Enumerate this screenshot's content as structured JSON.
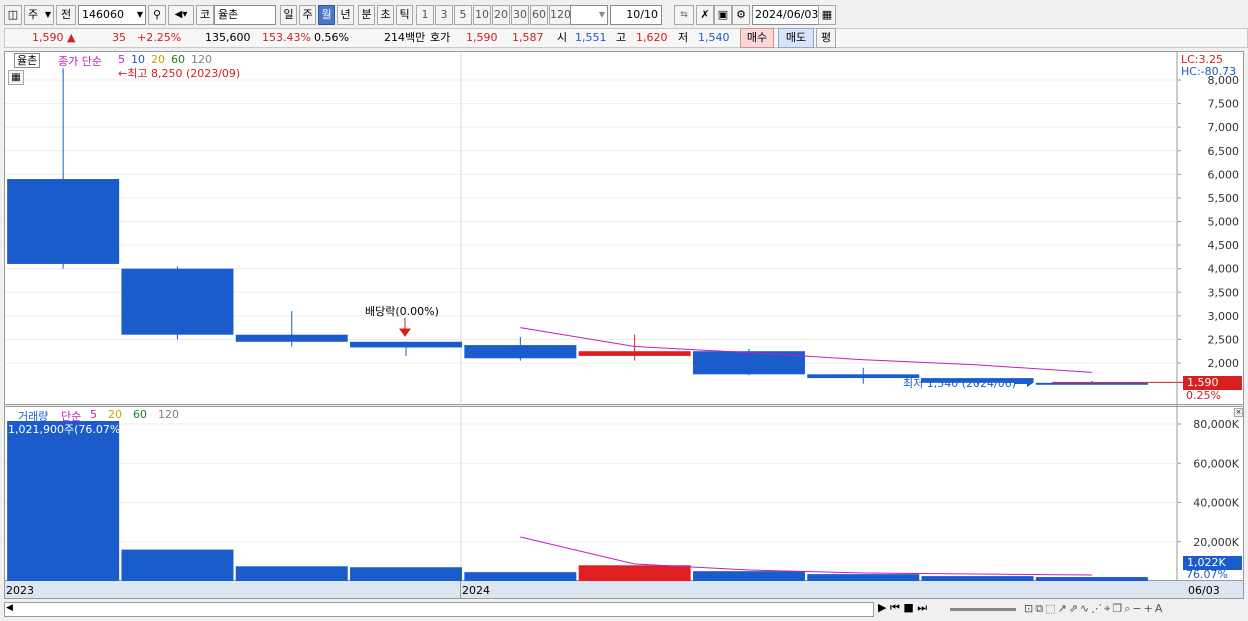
{
  "toolbar": {
    "period_type": "주",
    "market": "전",
    "code": "146060",
    "code_prefix": "코",
    "name": "율촌",
    "periods": [
      "일",
      "주",
      "월",
      "년",
      "분",
      "초",
      "틱"
    ],
    "selected_period": "월",
    "intervals": [
      "1",
      "3",
      "5",
      "10",
      "20",
      "30",
      "60",
      "120"
    ],
    "count": "10/10",
    "date": "2024/06/03"
  },
  "quote": {
    "price": "1,590",
    "arrow": "▲",
    "change": "35",
    "change_pct": "+2.25%",
    "volume": "135,600",
    "volume_ratio": "153.43%",
    "turnover": "0.56%",
    "amount": "214백만",
    "hoga_label": "호가",
    "ask": "1,590",
    "bid": "1,587",
    "open_label": "시",
    "open": "1,551",
    "high_label": "고",
    "high": "1,620",
    "low_label": "저",
    "low": "1,540",
    "buy_label": "매수",
    "sell_label": "매도",
    "eval_label": "평"
  },
  "price_panel": {
    "name_tag": "율촌",
    "indicator": "종가 단순",
    "ma_periods": [
      "5",
      "10",
      "20",
      "60",
      "120"
    ],
    "ma_colors": [
      "#c020c0",
      "#2050c0",
      "#d0a000",
      "#208020",
      "#808080"
    ],
    "max_label": "최고 8,250 (2023/09)",
    "min_label": "최저 1,540 (2024/06)",
    "dividend_label": "배당락(0.00%)",
    "lc": "LC:3.25",
    "hc": "HC:-80.73",
    "current_tag": "1,590",
    "current_pct": "0.25%",
    "y_labels": [
      "8,000",
      "7,500",
      "7,000",
      "6,500",
      "6,000",
      "5,500",
      "5,000",
      "4,500",
      "4,000",
      "3,500",
      "3,000",
      "2,500",
      "2,000"
    ]
  },
  "volume_panel": {
    "indicator_name": "거래량",
    "indicator": "단순",
    "ma_periods": [
      "5",
      "20",
      "60",
      "120"
    ],
    "ma_colors": [
      "#c020c0",
      "#d0a000",
      "#208020",
      "#808080"
    ],
    "max_label": "1,021,900주(76.07%)",
    "current_tag": "1,022K",
    "current_pct": "76.07%",
    "y_labels": [
      "80,000K",
      "60,000K",
      "40,000K",
      "20,000K"
    ]
  },
  "x_axis": {
    "labels": [
      "2023",
      "2024"
    ],
    "right_label": "06/03"
  },
  "colors": {
    "up": "#e02020",
    "down": "#1a5ccc",
    "ma5": "#c020c0",
    "selected": "#4a78c8"
  },
  "chart_data": {
    "type": "candlestick",
    "periods": [
      "2023-08",
      "2023-09",
      "2023-10",
      "2023-11",
      "2023-12",
      "2024-01",
      "2024-02",
      "2024-03",
      "2024-04",
      "2024-05",
      "2024-06"
    ],
    "candles": [
      {
        "open": 5900,
        "close": 4100,
        "high": 8250,
        "low": 4000,
        "dir": "down"
      },
      {
        "open": 4000,
        "close": 2600,
        "high": 4050,
        "low": 2500,
        "dir": "down"
      },
      {
        "open": 2600,
        "close": 2450,
        "high": 3100,
        "low": 2350,
        "dir": "down"
      },
      {
        "open": 2450,
        "close": 2330,
        "high": 2450,
        "low": 2150,
        "dir": "down"
      },
      {
        "open": 2380,
        "close": 2100,
        "high": 2550,
        "low": 2050,
        "dir": "down"
      },
      {
        "open": 2150,
        "close": 2250,
        "high": 2600,
        "low": 2050,
        "dir": "up"
      },
      {
        "open": 2250,
        "close": 1760,
        "high": 2300,
        "low": 1740,
        "dir": "down"
      },
      {
        "open": 1760,
        "close": 1680,
        "high": 1900,
        "low": 1560,
        "dir": "down"
      },
      {
        "open": 1680,
        "close": 1580,
        "high": 1680,
        "low": 1540,
        "dir": "down"
      },
      {
        "open": 1580,
        "close": 1560,
        "high": 1620,
        "low": 1540,
        "dir": "down"
      },
      {
        "open": 1551,
        "close": 1590,
        "high": 1620,
        "low": 1540,
        "dir": "up"
      }
    ],
    "ma5": [
      null,
      null,
      null,
      null,
      2750,
      2350,
      2220,
      2070,
      1960,
      1800,
      null
    ],
    "volume": [
      1021900,
      160000,
      75000,
      70000,
      45000,
      80000,
      50000,
      35000,
      25000,
      20000,
      13560
    ],
    "volume_ma5": [
      null,
      null,
      null,
      null,
      240000,
      86000,
      64000,
      58000,
      47000,
      42000,
      null
    ],
    "price_ylim": [
      1500,
      8300
    ],
    "volume_ylim": [
      0,
      85000000
    ]
  }
}
